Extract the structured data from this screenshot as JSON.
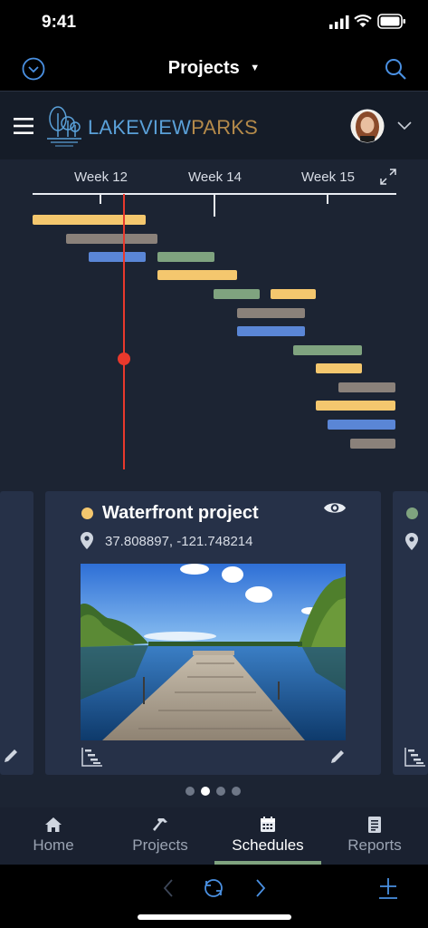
{
  "status": {
    "time": "9:41"
  },
  "nav": {
    "title": "Projects"
  },
  "brand": {
    "part1": "LAKEVIEW",
    "part2": "PARKS"
  },
  "timeline": {
    "weeks": [
      "Week 12",
      "Week 14",
      "Week 15"
    ],
    "colors": {
      "yellow": "#f4c76e",
      "gray": "#8a817a",
      "blue": "#5a86d6",
      "green": "#7fa37f",
      "today": "#e8392c"
    }
  },
  "card": {
    "title": "Waterfront project",
    "coords": "37.808897, -121.748214",
    "status_color": "#f4c76e"
  },
  "side_card_right": {
    "status_color": "#7fa37f"
  },
  "pagination": {
    "total": 4,
    "active": 2
  },
  "tabs": [
    {
      "label": "Home",
      "icon": "home-icon"
    },
    {
      "label": "Projects",
      "icon": "hammer-icon"
    },
    {
      "label": "Schedules",
      "icon": "calendar-icon",
      "active": true
    },
    {
      "label": "Reports",
      "icon": "document-icon"
    }
  ],
  "accent": "#4a90e2",
  "tab_active_color": "#7fa37f"
}
